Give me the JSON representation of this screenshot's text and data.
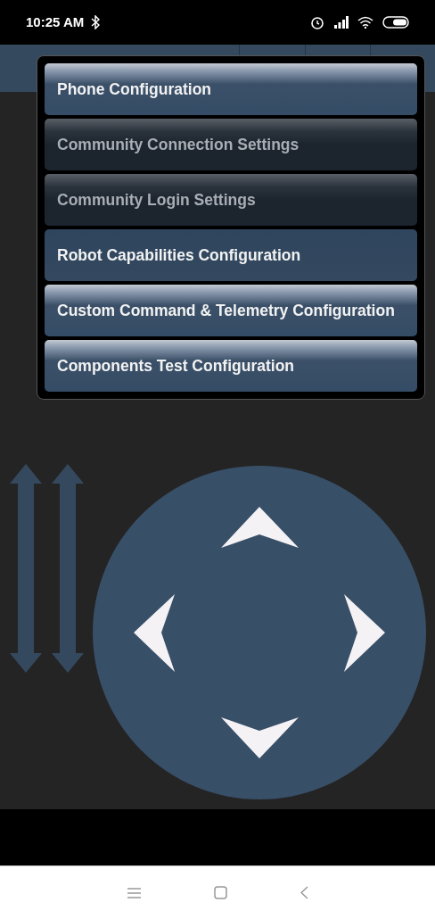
{
  "status_bar": {
    "time": "10:25 AM"
  },
  "menu": {
    "items": [
      {
        "label": "Phone Configuration",
        "disabled": false,
        "glossy": true
      },
      {
        "label": "Community Connection Settings",
        "disabled": true,
        "glossy": true
      },
      {
        "label": "Community Login Settings",
        "disabled": true,
        "glossy": true
      },
      {
        "label": "Robot Capabilities Configuration",
        "disabled": false,
        "glossy": false
      },
      {
        "label": "Custom Command & Telemetry Configuration",
        "disabled": false,
        "glossy": true
      },
      {
        "label": "Components Test Configuration",
        "disabled": false,
        "glossy": true
      }
    ]
  }
}
